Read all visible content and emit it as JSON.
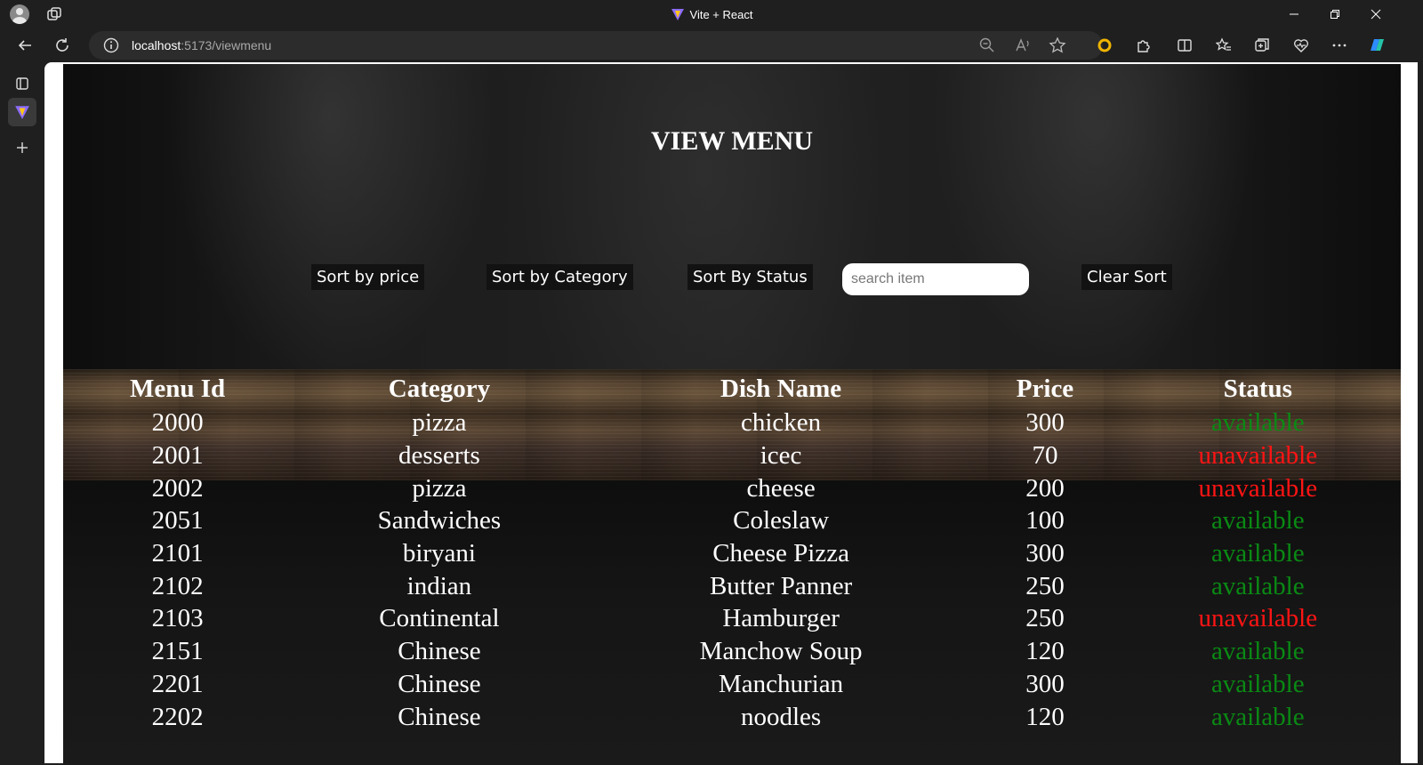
{
  "browser": {
    "tab_title": "Vite + React",
    "url_host": "localhost",
    "url_path": ":5173/viewmenu"
  },
  "page": {
    "title": "VIEW MENU",
    "controls": {
      "sort_price": "Sort by price",
      "sort_category": "Sort by Category",
      "sort_status": "Sort By Status",
      "search_placeholder": "search item",
      "clear_sort": "Clear Sort"
    },
    "table": {
      "headers": [
        "Menu Id",
        "Category",
        "Dish Name",
        "Price",
        "Status"
      ],
      "rows": [
        {
          "id": "2000",
          "category": "pizza",
          "dish": "chicken",
          "price": "300",
          "status": "available"
        },
        {
          "id": "2001",
          "category": "desserts",
          "dish": "icec",
          "price": "70",
          "status": "unavailable"
        },
        {
          "id": "2002",
          "category": "pizza",
          "dish": "cheese",
          "price": "200",
          "status": "unavailable"
        },
        {
          "id": "2051",
          "category": "Sandwiches",
          "dish": "Coleslaw",
          "price": "100",
          "status": "available"
        },
        {
          "id": "2101",
          "category": "biryani",
          "dish": "Cheese Pizza",
          "price": "300",
          "status": "available"
        },
        {
          "id": "2102",
          "category": "indian",
          "dish": "Butter Panner",
          "price": "250",
          "status": "available"
        },
        {
          "id": "2103",
          "category": "Continental",
          "dish": "Hamburger",
          "price": "250",
          "status": "unavailable"
        },
        {
          "id": "2151",
          "category": "Chinese",
          "dish": "Manchow Soup",
          "price": "120",
          "status": "available"
        },
        {
          "id": "2201",
          "category": "Chinese",
          "dish": "Manchurian",
          "price": "300",
          "status": "available"
        },
        {
          "id": "2202",
          "category": "Chinese",
          "dish": "noodles",
          "price": "120",
          "status": "available"
        }
      ]
    }
  },
  "colors": {
    "available": "#0a8a14",
    "unavailable": "#ff1414"
  }
}
